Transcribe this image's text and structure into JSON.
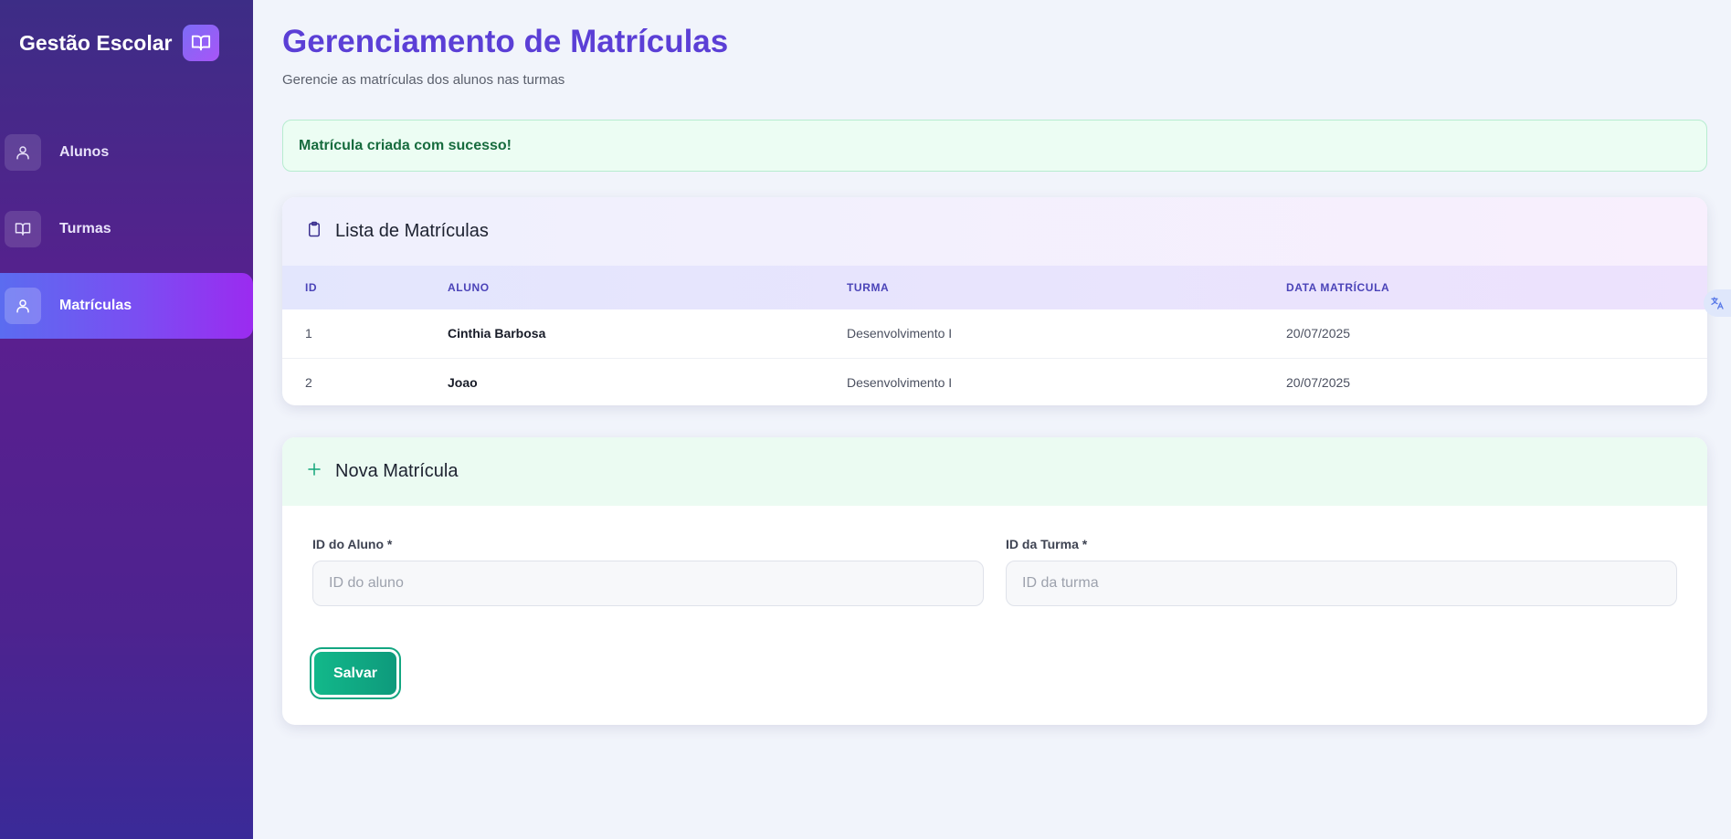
{
  "sidebar": {
    "brand_title": "Gestão Escolar",
    "brand_icon": "book-open-icon",
    "items": [
      {
        "label": "Alunos",
        "icon": "user-icon",
        "active": false
      },
      {
        "label": "Turmas",
        "icon": "book-open-icon",
        "active": false
      },
      {
        "label": "Matrículas",
        "icon": "user-icon",
        "active": true
      }
    ]
  },
  "header": {
    "title": "Gerenciamento de Matrículas",
    "subtitle": "Gerencie as matrículas dos alunos nas turmas"
  },
  "alert": {
    "message": "Matrícula criada com sucesso!"
  },
  "list": {
    "title": "Lista de Matrículas",
    "icon": "clipboard-icon",
    "columns": [
      "ID",
      "ALUNO",
      "TURMA",
      "DATA MATRÍCULA"
    ],
    "rows": [
      {
        "id": "1",
        "aluno": "Cinthia Barbosa",
        "turma": "Desenvolvimento I",
        "data": "20/07/2025"
      },
      {
        "id": "2",
        "aluno": "Joao",
        "turma": "Desenvolvimento I",
        "data": "20/07/2025"
      }
    ]
  },
  "form": {
    "title": "Nova Matrícula",
    "icon": "plus-icon",
    "aluno_label": "ID do Aluno *",
    "aluno_placeholder": "ID do aluno",
    "aluno_value": "",
    "turma_label": "ID da Turma *",
    "turma_placeholder": "ID da turma",
    "turma_value": "",
    "save_label": "Salvar"
  },
  "colors": {
    "accent": "#5b3fd6",
    "success": "#12b88a",
    "sidebar_active": "#7b4df2"
  },
  "floating": {
    "translate_icon": "translate-icon"
  }
}
